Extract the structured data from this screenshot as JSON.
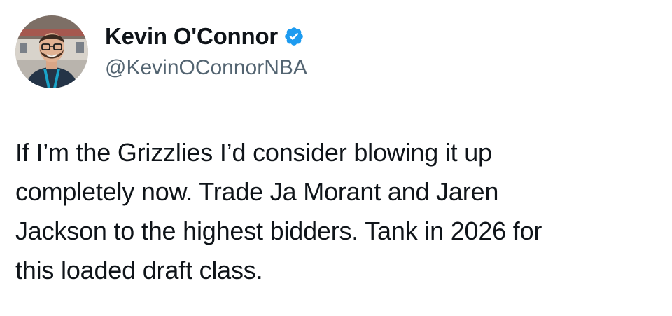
{
  "author": {
    "display_name": "Kevin O'Connor",
    "handle": "@KevinOConnorNBA",
    "verified": true,
    "avatar_icon": "user-avatar",
    "verified_icon": "verified-badge-icon"
  },
  "tweet": {
    "text": "If I’m the Grizzlies I’d consider blowing it up\ncompletely now. Trade Ja Morant and Jaren\nJackson to the highest bidders. Tank in 2026 for\nthis loaded draft class."
  },
  "colors": {
    "text": "#0f1419",
    "secondary_text": "#536471",
    "verified_blue": "#1d9bf0",
    "background": "#ffffff"
  }
}
